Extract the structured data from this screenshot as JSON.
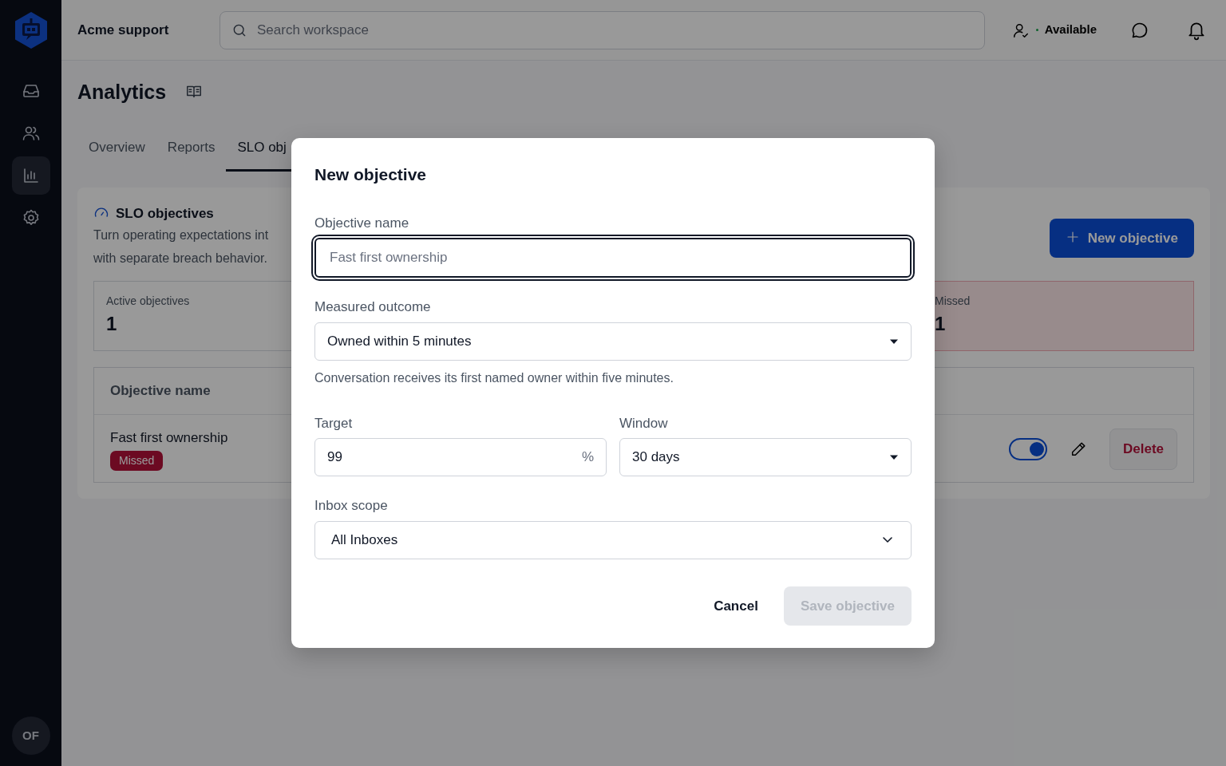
{
  "app": {
    "name": "Acme support",
    "user_initials": "OF"
  },
  "sidebar": {
    "items": [
      {
        "kind": "inbox",
        "selected": false
      },
      {
        "kind": "people",
        "selected": false
      },
      {
        "kind": "chart",
        "selected": true
      },
      {
        "kind": "settings",
        "selected": false
      }
    ]
  },
  "search": {
    "placeholder": "Search workspace"
  },
  "presence": {
    "label": "Available"
  },
  "page": {
    "title": "Analytics"
  },
  "tabs": [
    {
      "label": "Overview",
      "selected": false
    },
    {
      "label": "Reports",
      "selected": false
    },
    {
      "label": "SLO obj",
      "selected": true
    }
  ],
  "panel": {
    "title": "SLO objectives",
    "description_lines": [
      "Turn operating expectations int",
      "with separate breach behavior."
    ],
    "new_button": "New objective",
    "stats": [
      {
        "label": "Active objectives",
        "value": "1",
        "kind": "neutral"
      },
      {
        "label": "Missed",
        "value": "1",
        "kind": "danger"
      }
    ],
    "table": {
      "columns": [
        "Objective name"
      ],
      "rows": [
        {
          "name": "Fast first ownership",
          "status": "Missed",
          "enabled": true,
          "action": "Delete"
        }
      ]
    }
  },
  "dialog": {
    "title": "New objective",
    "name_field": {
      "label": "Objective name",
      "placeholder": "Fast first ownership",
      "focused": true
    },
    "outcome_field": {
      "label": "Measured outcome",
      "value": "Owned within 5 minutes",
      "help": "Conversation receives its first named owner within five minutes."
    },
    "target_field": {
      "label": "Target",
      "value": "99",
      "suffix": "%"
    },
    "window_field": {
      "label": "Window",
      "value": "30 days"
    },
    "scope_field": {
      "label": "Inbox scope",
      "value": "All Inboxes"
    },
    "cancel": "Cancel",
    "save": {
      "label": "Save objective",
      "disabled": true
    }
  }
}
